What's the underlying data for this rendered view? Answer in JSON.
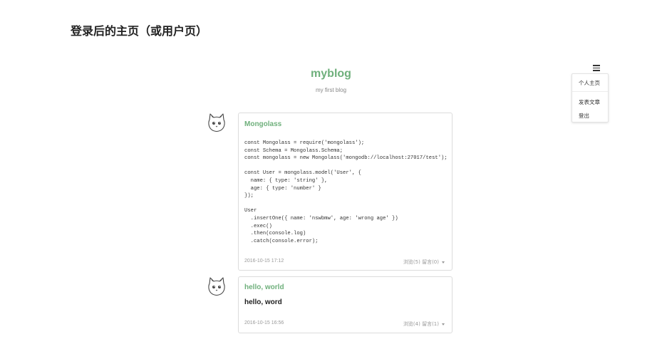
{
  "heading": "登录后的主页（或用户页）",
  "blog": {
    "title": "myblog",
    "subtitle": "my first blog"
  },
  "menu": {
    "icon": "hamburger-icon",
    "items": [
      "个人主页",
      "发表文章",
      "登出"
    ]
  },
  "posts": [
    {
      "title": "Mongolass",
      "content": "const Mongolass = require('mongolass');\nconst Schema = Mongolass.Schema;\nconst mongolass = new Mongolass('mongodb://localhost:27017/test');\n\nconst User = mongolass.model('User', {\n  name: { type: 'string' },\n  age: { type: 'number' }\n});\n\nUser\n  .insertOne({ name: 'nswbmw', age: 'wrong age' })\n  .exec()\n  .then(console.log)\n  .catch(console.error);",
      "date": "2016-10-15 17:12",
      "stats": "浏览(5) 留言(0)",
      "avatar": "cat-avatar-icon"
    },
    {
      "title": "hello, world",
      "content": "hello, word",
      "date": "2016-10-15 16:56",
      "stats": "浏览(4) 留言(1)",
      "avatar": "cat-avatar-icon"
    }
  ]
}
